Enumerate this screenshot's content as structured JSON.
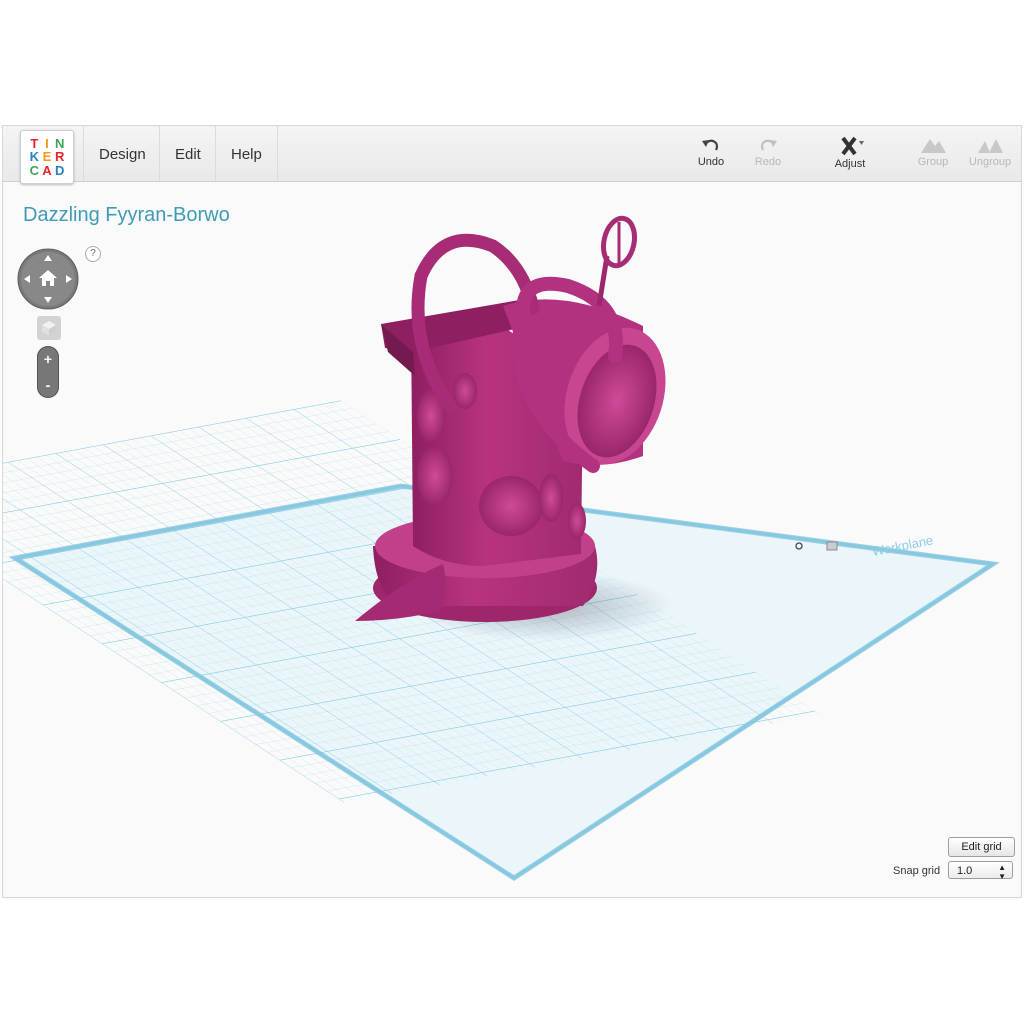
{
  "logo": {
    "letters": [
      "T",
      "I",
      "N",
      "K",
      "E",
      "R",
      "C",
      "A",
      "D"
    ],
    "colors": [
      "#e8232e",
      "#f59a1c",
      "#3aa557",
      "#2a7ec4",
      "#f59a1c",
      "#e8232e",
      "#3aa557",
      "#e8232e",
      "#2a7ec4"
    ]
  },
  "menu": {
    "design": "Design",
    "edit": "Edit",
    "help": "Help"
  },
  "tools": {
    "undo": "Undo",
    "redo": "Redo",
    "adjust": "Adjust",
    "group": "Group",
    "ungroup": "Ungroup"
  },
  "design_title": "Dazzling Fyyran-Borwo",
  "help_symbol": "?",
  "zoom": {
    "plus": "+",
    "minus": "-"
  },
  "grid_label": "Workplane",
  "edit_grid_label": "Edit grid",
  "snap": {
    "label": "Snap grid",
    "value": "1.0"
  },
  "colors": {
    "accent": "#3f9bb4",
    "model": "#b8337f",
    "grid": "#7ec8e0"
  }
}
